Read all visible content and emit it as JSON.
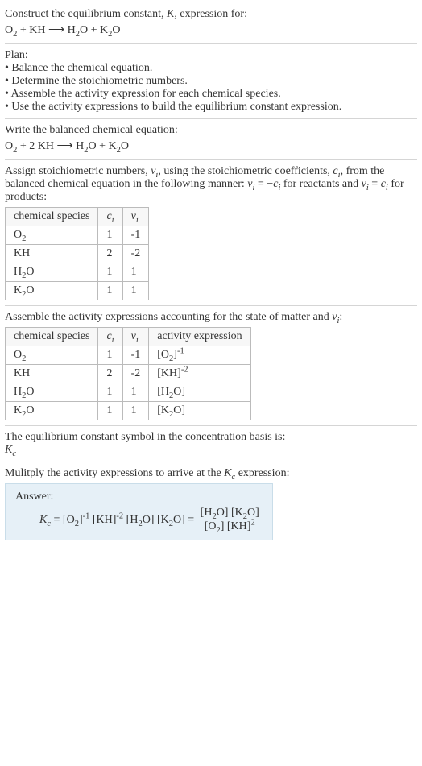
{
  "intro": {
    "prompt_prefix": "Construct the equilibrium constant, ",
    "K": "K",
    "prompt_suffix": ", expression for:",
    "equation_html": "O<sub>2</sub> + KH <span class='arrow'>⟶</span> H<sub>2</sub>O + K<sub>2</sub>O"
  },
  "plan": {
    "heading": "Plan:",
    "items": [
      "• Balance the chemical equation.",
      "• Determine the stoichiometric numbers.",
      "• Assemble the activity expression for each chemical species.",
      "• Use the activity expressions to build the equilibrium constant expression."
    ]
  },
  "balanced": {
    "heading": "Write the balanced chemical equation:",
    "equation_html": "O<sub>2</sub> + 2 KH <span class='arrow'>⟶</span> H<sub>2</sub>O + K<sub>2</sub>O"
  },
  "stoich": {
    "text_html": "Assign stoichiometric numbers, <i>ν<sub>i</sub></i>, using the stoichiometric coefficients, <i>c<sub>i</sub></i>, from the balanced chemical equation in the following manner: <i>ν<sub>i</sub></i> = −<i>c<sub>i</sub></i> for reactants and <i>ν<sub>i</sub></i> = <i>c<sub>i</sub></i> for products:",
    "headers": [
      "chemical species",
      "c_i",
      "ν_i"
    ],
    "rows": [
      {
        "species_html": "O<sub>2</sub>",
        "c": "1",
        "v": "-1"
      },
      {
        "species_html": "KH",
        "c": "2",
        "v": "-2"
      },
      {
        "species_html": "H<sub>2</sub>O",
        "c": "1",
        "v": "1"
      },
      {
        "species_html": "K<sub>2</sub>O",
        "c": "1",
        "v": "1"
      }
    ]
  },
  "activity": {
    "text_html": "Assemble the activity expressions accounting for the state of matter and <i>ν<sub>i</sub></i>:",
    "headers": [
      "chemical species",
      "c_i",
      "ν_i",
      "activity expression"
    ],
    "rows": [
      {
        "species_html": "O<sub>2</sub>",
        "c": "1",
        "v": "-1",
        "expr_html": "[O<sub>2</sub>]<sup>-1</sup>"
      },
      {
        "species_html": "KH",
        "c": "2",
        "v": "-2",
        "expr_html": "[KH]<sup>-2</sup>"
      },
      {
        "species_html": "H<sub>2</sub>O",
        "c": "1",
        "v": "1",
        "expr_html": "[H<sub>2</sub>O]"
      },
      {
        "species_html": "K<sub>2</sub>O",
        "c": "1",
        "v": "1",
        "expr_html": "[K<sub>2</sub>O]"
      }
    ]
  },
  "symbol": {
    "line1": "The equilibrium constant symbol in the concentration basis is:",
    "kc_html": "<i>K<sub>c</sub></i>"
  },
  "multiply": {
    "text_html": "Mulitply the activity expressions to arrive at the <i>K<sub>c</sub></i> expression:"
  },
  "answer": {
    "label": "Answer:",
    "lhs_html": "<i>K<sub>c</sub></i> = [O<sub>2</sub>]<sup>-1</sup> [KH]<sup>-2</sup> [H<sub>2</sub>O] [K<sub>2</sub>O] = ",
    "num_html": "[H<sub>2</sub>O] [K<sub>2</sub>O]",
    "den_html": "[O<sub>2</sub>] [KH]<sup>2</sup>"
  },
  "chart_data": {
    "type": "table",
    "tables": [
      {
        "title": "stoichiometric numbers",
        "columns": [
          "chemical species",
          "c_i",
          "ν_i"
        ],
        "rows": [
          [
            "O2",
            1,
            -1
          ],
          [
            "KH",
            2,
            -2
          ],
          [
            "H2O",
            1,
            1
          ],
          [
            "K2O",
            1,
            1
          ]
        ]
      },
      {
        "title": "activity expressions",
        "columns": [
          "chemical species",
          "c_i",
          "ν_i",
          "activity expression"
        ],
        "rows": [
          [
            "O2",
            1,
            -1,
            "[O2]^-1"
          ],
          [
            "KH",
            2,
            -2,
            "[KH]^-2"
          ],
          [
            "H2O",
            1,
            1,
            "[H2O]"
          ],
          [
            "K2O",
            1,
            1,
            "[K2O]"
          ]
        ]
      }
    ]
  }
}
